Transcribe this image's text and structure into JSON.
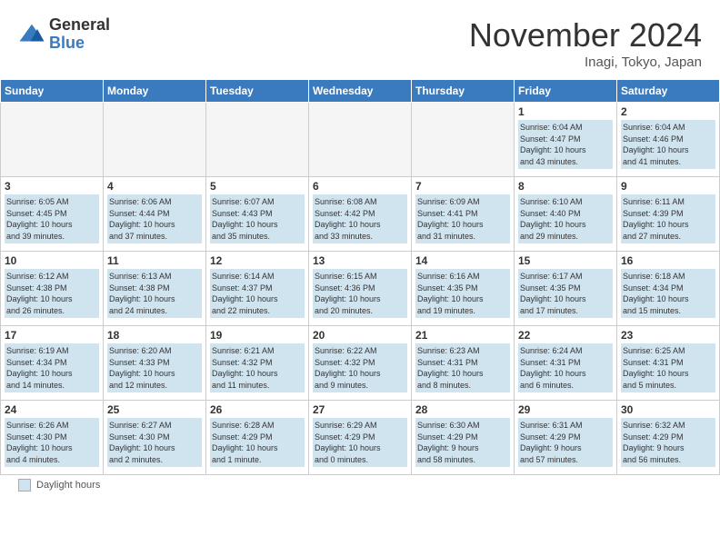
{
  "header": {
    "logo_general": "General",
    "logo_blue": "Blue",
    "month_title": "November 2024",
    "location": "Inagi, Tokyo, Japan"
  },
  "footer": {
    "daylight_label": "Daylight hours"
  },
  "weekdays": [
    "Sunday",
    "Monday",
    "Tuesday",
    "Wednesday",
    "Thursday",
    "Friday",
    "Saturday"
  ],
  "weeks": [
    [
      {
        "day": "",
        "info": ""
      },
      {
        "day": "",
        "info": ""
      },
      {
        "day": "",
        "info": ""
      },
      {
        "day": "",
        "info": ""
      },
      {
        "day": "",
        "info": ""
      },
      {
        "day": "1",
        "info": "Sunrise: 6:04 AM\nSunset: 4:47 PM\nDaylight: 10 hours\nand 43 minutes."
      },
      {
        "day": "2",
        "info": "Sunrise: 6:04 AM\nSunset: 4:46 PM\nDaylight: 10 hours\nand 41 minutes."
      }
    ],
    [
      {
        "day": "3",
        "info": "Sunrise: 6:05 AM\nSunset: 4:45 PM\nDaylight: 10 hours\nand 39 minutes."
      },
      {
        "day": "4",
        "info": "Sunrise: 6:06 AM\nSunset: 4:44 PM\nDaylight: 10 hours\nand 37 minutes."
      },
      {
        "day": "5",
        "info": "Sunrise: 6:07 AM\nSunset: 4:43 PM\nDaylight: 10 hours\nand 35 minutes."
      },
      {
        "day": "6",
        "info": "Sunrise: 6:08 AM\nSunset: 4:42 PM\nDaylight: 10 hours\nand 33 minutes."
      },
      {
        "day": "7",
        "info": "Sunrise: 6:09 AM\nSunset: 4:41 PM\nDaylight: 10 hours\nand 31 minutes."
      },
      {
        "day": "8",
        "info": "Sunrise: 6:10 AM\nSunset: 4:40 PM\nDaylight: 10 hours\nand 29 minutes."
      },
      {
        "day": "9",
        "info": "Sunrise: 6:11 AM\nSunset: 4:39 PM\nDaylight: 10 hours\nand 27 minutes."
      }
    ],
    [
      {
        "day": "10",
        "info": "Sunrise: 6:12 AM\nSunset: 4:38 PM\nDaylight: 10 hours\nand 26 minutes."
      },
      {
        "day": "11",
        "info": "Sunrise: 6:13 AM\nSunset: 4:38 PM\nDaylight: 10 hours\nand 24 minutes."
      },
      {
        "day": "12",
        "info": "Sunrise: 6:14 AM\nSunset: 4:37 PM\nDaylight: 10 hours\nand 22 minutes."
      },
      {
        "day": "13",
        "info": "Sunrise: 6:15 AM\nSunset: 4:36 PM\nDaylight: 10 hours\nand 20 minutes."
      },
      {
        "day": "14",
        "info": "Sunrise: 6:16 AM\nSunset: 4:35 PM\nDaylight: 10 hours\nand 19 minutes."
      },
      {
        "day": "15",
        "info": "Sunrise: 6:17 AM\nSunset: 4:35 PM\nDaylight: 10 hours\nand 17 minutes."
      },
      {
        "day": "16",
        "info": "Sunrise: 6:18 AM\nSunset: 4:34 PM\nDaylight: 10 hours\nand 15 minutes."
      }
    ],
    [
      {
        "day": "17",
        "info": "Sunrise: 6:19 AM\nSunset: 4:34 PM\nDaylight: 10 hours\nand 14 minutes."
      },
      {
        "day": "18",
        "info": "Sunrise: 6:20 AM\nSunset: 4:33 PM\nDaylight: 10 hours\nand 12 minutes."
      },
      {
        "day": "19",
        "info": "Sunrise: 6:21 AM\nSunset: 4:32 PM\nDaylight: 10 hours\nand 11 minutes."
      },
      {
        "day": "20",
        "info": "Sunrise: 6:22 AM\nSunset: 4:32 PM\nDaylight: 10 hours\nand 9 minutes."
      },
      {
        "day": "21",
        "info": "Sunrise: 6:23 AM\nSunset: 4:31 PM\nDaylight: 10 hours\nand 8 minutes."
      },
      {
        "day": "22",
        "info": "Sunrise: 6:24 AM\nSunset: 4:31 PM\nDaylight: 10 hours\nand 6 minutes."
      },
      {
        "day": "23",
        "info": "Sunrise: 6:25 AM\nSunset: 4:31 PM\nDaylight: 10 hours\nand 5 minutes."
      }
    ],
    [
      {
        "day": "24",
        "info": "Sunrise: 6:26 AM\nSunset: 4:30 PM\nDaylight: 10 hours\nand 4 minutes."
      },
      {
        "day": "25",
        "info": "Sunrise: 6:27 AM\nSunset: 4:30 PM\nDaylight: 10 hours\nand 2 minutes."
      },
      {
        "day": "26",
        "info": "Sunrise: 6:28 AM\nSunset: 4:29 PM\nDaylight: 10 hours\nand 1 minute."
      },
      {
        "day": "27",
        "info": "Sunrise: 6:29 AM\nSunset: 4:29 PM\nDaylight: 10 hours\nand 0 minutes."
      },
      {
        "day": "28",
        "info": "Sunrise: 6:30 AM\nSunset: 4:29 PM\nDaylight: 9 hours\nand 58 minutes."
      },
      {
        "day": "29",
        "info": "Sunrise: 6:31 AM\nSunset: 4:29 PM\nDaylight: 9 hours\nand 57 minutes."
      },
      {
        "day": "30",
        "info": "Sunrise: 6:32 AM\nSunset: 4:29 PM\nDaylight: 9 hours\nand 56 minutes."
      }
    ]
  ]
}
